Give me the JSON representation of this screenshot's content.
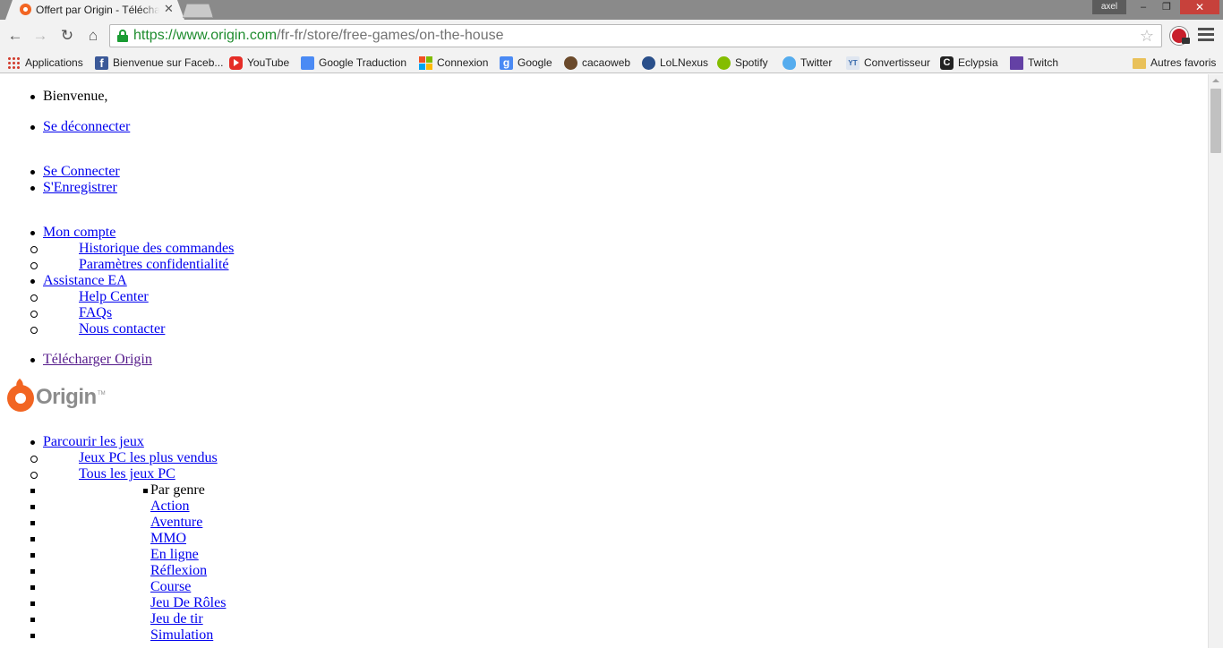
{
  "browser": {
    "tab_title": "Offert par Origin - Télécha",
    "tab_close": "✕",
    "user_badge": "axel",
    "window_buttons": {
      "minimize": "–",
      "restore": "❐",
      "close": "✕"
    },
    "nav": {
      "back": "←",
      "forward": "→",
      "reload": "↻",
      "home": "⌂"
    },
    "url_host": "https://www.origin.com",
    "url_path": "/fr-fr/store/free-games/on-the-house",
    "star": "☆",
    "bookmarks": [
      {
        "label": "Applications",
        "icon": "apps-grid-icon"
      },
      {
        "label": "Bienvenue sur Faceb...",
        "icon": "facebook-icon"
      },
      {
        "label": "YouTube",
        "icon": "youtube-icon"
      },
      {
        "label": "Google Traduction",
        "icon": "google-translate-icon"
      },
      {
        "label": "Connexion",
        "icon": "windows-icon"
      },
      {
        "label": "Google",
        "icon": "google-icon"
      },
      {
        "label": "cacaoweb",
        "icon": "cacaoweb-icon"
      },
      {
        "label": "LoLNexus",
        "icon": "lolnexus-icon"
      },
      {
        "label": "Spotify",
        "icon": "spotify-icon"
      },
      {
        "label": "Twitter",
        "icon": "twitter-icon"
      },
      {
        "label": "Convertisseur",
        "icon": "converter-icon"
      },
      {
        "label": "Eclypsia",
        "icon": "eclypsia-icon"
      },
      {
        "label": "Twitch",
        "icon": "twitch-icon"
      }
    ],
    "other_bookmarks": "Autres favoris"
  },
  "page": {
    "welcome": "Bienvenue,",
    "logout": "Se déconnecter",
    "login": "Se Connecter",
    "register": "S'Enregistrer",
    "account": {
      "label": "Mon compte",
      "items": [
        "Historique des commandes",
        "Paramètres confidentialité"
      ]
    },
    "support": {
      "label": "Assistance EA",
      "items": [
        "Help Center",
        "FAQs",
        "Nous contacter"
      ]
    },
    "download": "Télécharger Origin",
    "logo_text": "Origin",
    "logo_tm": "TM",
    "browse": {
      "label": "Parcourir les jeux",
      "bestsellers": "Jeux PC les plus vendus",
      "all_games": "Tous les jeux PC",
      "genre_heading": "Par genre",
      "genres": [
        "Action",
        "Aventure",
        "MMO",
        "En ligne",
        "Réflexion",
        "Course",
        "Jeu De Rôles",
        "Jeu de tir",
        "Simulation"
      ]
    }
  }
}
